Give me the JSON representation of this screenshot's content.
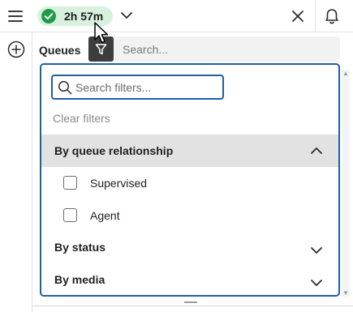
{
  "topbar": {
    "timer": "2h 57m",
    "timer_color": "#d8f1de",
    "status_icon": "check-circle-icon",
    "chevron_icon": "chevron-down-icon",
    "close_icon": "close-icon",
    "notifications_icon": "bell-icon"
  },
  "rail": {
    "add_icon": "plus-circle-icon"
  },
  "queues": {
    "label": "Queues",
    "filter_icon": "filter-icon",
    "search_placeholder": "Search..."
  },
  "filter_panel": {
    "search_placeholder": "Search filters...",
    "clear_label": "Clear filters",
    "groups": [
      {
        "label": "By queue relationship",
        "expanded": true,
        "options": [
          {
            "label": "Supervised",
            "checked": false
          },
          {
            "label": "Agent",
            "checked": false
          }
        ]
      },
      {
        "label": "By status",
        "expanded": false
      },
      {
        "label": "By media",
        "expanded": false
      }
    ]
  },
  "colors": {
    "accent": "#1f5fa9",
    "status_green": "#1e9c4a",
    "filter_button": "#3d3d3d"
  }
}
